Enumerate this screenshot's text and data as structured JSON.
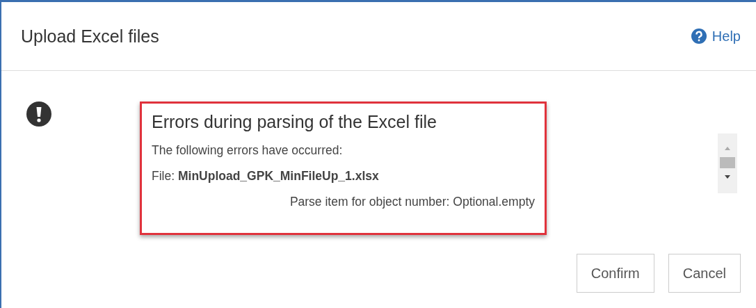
{
  "dialog": {
    "title": "Upload Excel files",
    "help": "Help"
  },
  "error": {
    "title": "Errors during parsing of the Excel file",
    "message": "The following errors have occurred:",
    "file_line": "File: **MinUpload_GPK_MinFileUp_1.xlsx**",
    "detail": "Parse item for object number: Optional.empty"
  },
  "buttons": [
    "Confirm",
    "Cancel"
  ]
}
